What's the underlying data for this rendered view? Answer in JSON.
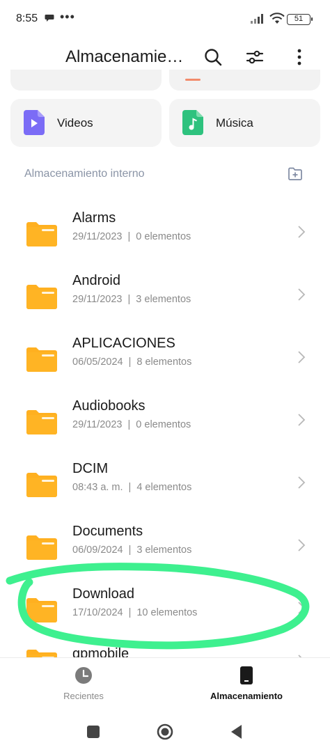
{
  "status_bar": {
    "time": "8:55",
    "dots": "•••",
    "battery": "51",
    "icons": [
      "chat-bubble-icon",
      "signal-icon",
      "wifi-icon",
      "battery-icon"
    ]
  },
  "header": {
    "title": "Almacenamie…",
    "icons": [
      "search-icon",
      "filter-icon",
      "more-vert-icon"
    ]
  },
  "categories": [
    {
      "label": "Videos",
      "icon": "video-file-icon",
      "color": "#7b6cf6"
    },
    {
      "label": "Música",
      "icon": "music-file-icon",
      "color": "#2ec27e"
    }
  ],
  "section": {
    "title": "Almacenamiento interno",
    "action_icon": "add-folder-icon"
  },
  "folders": [
    {
      "name": "Alarms",
      "date": "29/11/2023",
      "sep": "|",
      "count": "0 elementos"
    },
    {
      "name": "Android",
      "date": "29/11/2023",
      "sep": "|",
      "count": "3 elementos"
    },
    {
      "name": "APLICACIONES",
      "date": "06/05/2024",
      "sep": "|",
      "count": "8 elementos"
    },
    {
      "name": "Audiobooks",
      "date": "29/11/2023",
      "sep": "|",
      "count": "0 elementos"
    },
    {
      "name": "DCIM",
      "date": "08:43 a. m.",
      "sep": "|",
      "count": "4 elementos"
    },
    {
      "name": "Documents",
      "date": "06/09/2024",
      "sep": "|",
      "count": "3 elementos"
    },
    {
      "name": "Download",
      "date": "17/10/2024",
      "sep": "|",
      "count": "10 elementos"
    },
    {
      "name": "gpmobile",
      "date": "",
      "sep": "",
      "count": ""
    }
  ],
  "bottom_nav": {
    "recent_label": "Recientes",
    "storage_label": "Almacenamiento"
  },
  "colors": {
    "folder": "#ffb020",
    "folder_tab": "#f5a312",
    "highlight": "#3ef08f",
    "meta_text": "#8a8a8a",
    "section_text": "#8a94a6"
  }
}
